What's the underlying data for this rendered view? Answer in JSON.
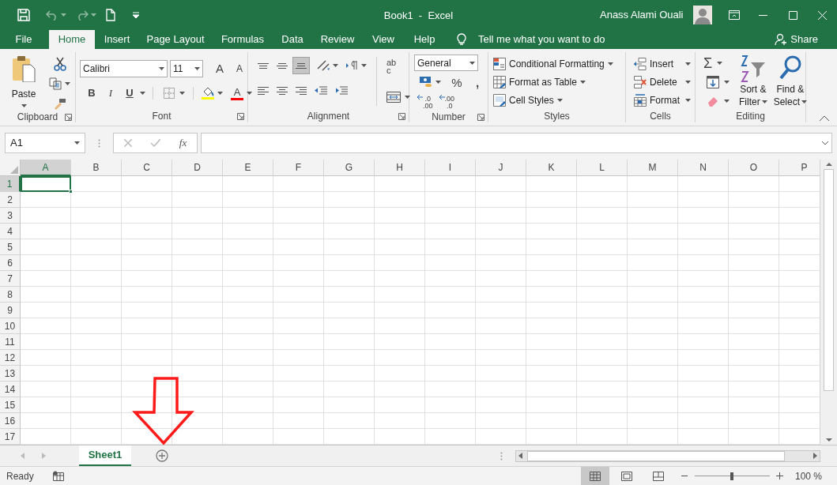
{
  "title_bar": {
    "title": "Book1  -  Excel",
    "user_name": "Anass Alami Ouali"
  },
  "tabs": [
    {
      "label": "File",
      "selected": false
    },
    {
      "label": "Home",
      "selected": true
    },
    {
      "label": "Insert",
      "selected": false
    },
    {
      "label": "Page Layout",
      "selected": false
    },
    {
      "label": "Formulas",
      "selected": false
    },
    {
      "label": "Data",
      "selected": false
    },
    {
      "label": "Review",
      "selected": false
    },
    {
      "label": "View",
      "selected": false
    },
    {
      "label": "Help",
      "selected": false
    }
  ],
  "tell_me": {
    "placeholder": "Tell me what you want to do"
  },
  "share": "Share",
  "ribbon": {
    "clipboard": {
      "label": "Clipboard",
      "paste": "Paste"
    },
    "font": {
      "label": "Font",
      "name": "Calibri",
      "size": "11",
      "grow": "A",
      "shrink": "A",
      "bold": "B",
      "italic": "I",
      "underline": "U",
      "font_color": "A"
    },
    "alignment": {
      "label": "Alignment",
      "bottom_align_selected": true,
      "wrap_text": [
        "ab",
        "c"
      ]
    },
    "number": {
      "label": "Number",
      "format": "General",
      "percent": "%",
      "comma": ",",
      "increase_decimal": [
        ".0",
        ".00"
      ],
      "decrease_decimal": [
        ".00",
        ".0"
      ]
    },
    "styles": {
      "label": "Styles",
      "items": [
        "Conditional Formatting",
        "Format as Table",
        "Cell Styles"
      ]
    },
    "cells": {
      "label": "Cells",
      "items": [
        "Insert",
        "Delete",
        "Format"
      ]
    },
    "editing": {
      "label": "Editing",
      "sum": "Σ",
      "sort": [
        "Sort &",
        "Filter"
      ],
      "find": [
        "Find &",
        "Select"
      ]
    }
  },
  "formula_bar": {
    "name_box": "A1",
    "fx": "fx"
  },
  "sheet": {
    "columns": [
      {
        "label": "A",
        "selected": true
      },
      {
        "label": "B",
        "selected": false
      },
      {
        "label": "C",
        "selected": false
      },
      {
        "label": "D",
        "selected": false
      },
      {
        "label": "E",
        "selected": false
      },
      {
        "label": "F",
        "selected": false
      },
      {
        "label": "G",
        "selected": false
      },
      {
        "label": "H",
        "selected": false
      },
      {
        "label": "I",
        "selected": false
      },
      {
        "label": "J",
        "selected": false
      },
      {
        "label": "K",
        "selected": false
      },
      {
        "label": "L",
        "selected": false
      },
      {
        "label": "M",
        "selected": false
      },
      {
        "label": "N",
        "selected": false
      },
      {
        "label": "O",
        "selected": false
      },
      {
        "label": "P",
        "selected": false
      }
    ],
    "rows": [
      {
        "label": "1",
        "selected": true
      },
      {
        "label": "2",
        "selected": false
      },
      {
        "label": "3",
        "selected": false
      },
      {
        "label": "4",
        "selected": false
      },
      {
        "label": "5",
        "selected": false
      },
      {
        "label": "6",
        "selected": false
      },
      {
        "label": "7",
        "selected": false
      },
      {
        "label": "8",
        "selected": false
      },
      {
        "label": "9",
        "selected": false
      },
      {
        "label": "10",
        "selected": false
      },
      {
        "label": "11",
        "selected": false
      },
      {
        "label": "12",
        "selected": false
      },
      {
        "label": "13",
        "selected": false
      },
      {
        "label": "14",
        "selected": false
      },
      {
        "label": "15",
        "selected": false
      },
      {
        "label": "16",
        "selected": false
      },
      {
        "label": "17",
        "selected": false
      }
    ]
  },
  "sheet_tabs": [
    {
      "label": "Sheet1",
      "selected": true
    }
  ],
  "status_bar": {
    "status": "Ready",
    "views": [
      {
        "kind": "normal",
        "selected": true
      },
      {
        "kind": "page_layout",
        "selected": false
      },
      {
        "kind": "page_break",
        "selected": false
      }
    ],
    "zoom": {
      "level": 0.5,
      "reading": "100 %"
    }
  }
}
